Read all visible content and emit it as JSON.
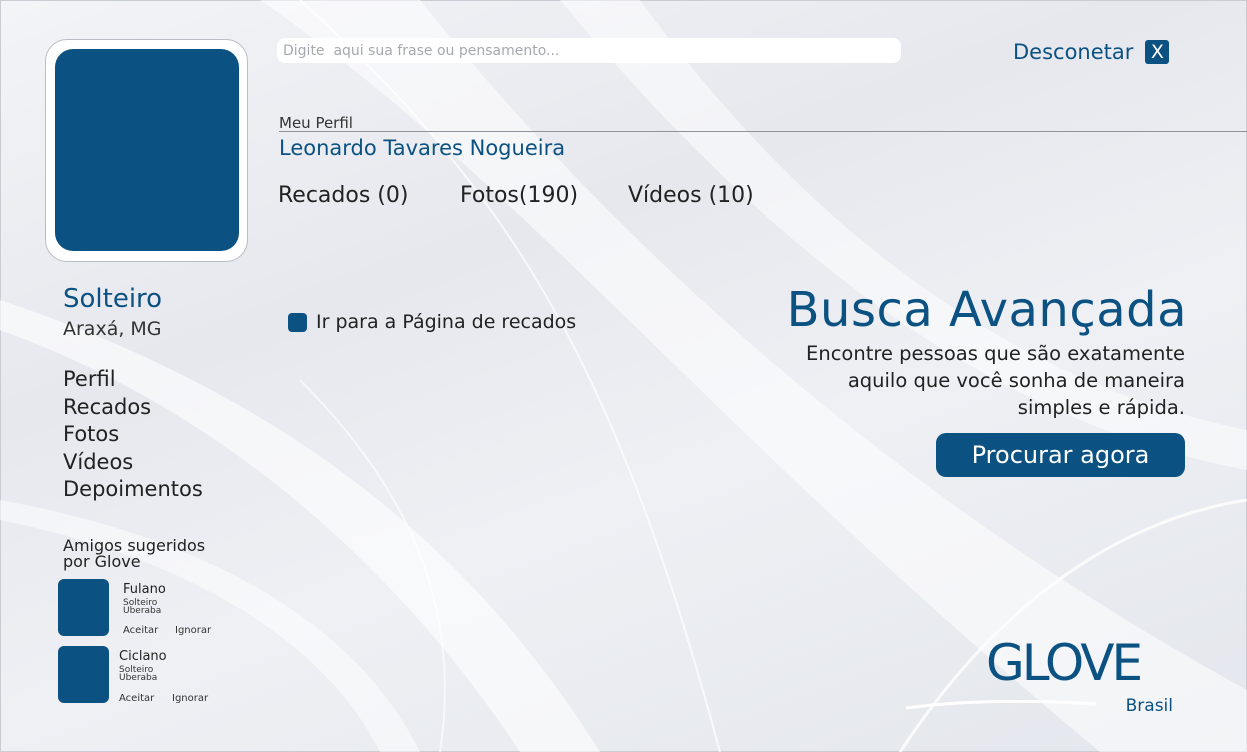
{
  "status_input": {
    "placeholder": "Digite  aqui sua frase ou pensamento..."
  },
  "logout": {
    "label": "Desconetar",
    "close_symbol": "X"
  },
  "profile": {
    "section_title": "Meu Perfil",
    "name": "Leonardo Tavares Nogueira",
    "stats": {
      "recados": "Recados (0)",
      "fotos": "Fotos(190)",
      "videos": "Vídeos (10)"
    }
  },
  "sidebar": {
    "relationship_status": "Solteiro",
    "location": "Araxá, MG",
    "nav": [
      "Perfil",
      "Recados",
      "Fotos",
      "Vídeos",
      "Depoimentos"
    ],
    "suggested_title_line1": "Amigos sugeridos",
    "suggested_title_line2": "por  Glove",
    "friends": [
      {
        "name": "Fulano",
        "status": "Solteiro",
        "city": "Uberaba",
        "accept": "Aceitar",
        "ignore": "Ignorar"
      },
      {
        "name": "Ciclano",
        "status": "Solteiro",
        "city": "Uberaba",
        "accept": "Aceitar",
        "ignore": "Ignorar"
      }
    ]
  },
  "goto_recados": {
    "label": "Ir para a Página de recados"
  },
  "advanced_search": {
    "title": "Busca Avançada",
    "description_line1": "Encontre pessoas que são exatamente",
    "description_line2": "aquilo que você sonha de maneira",
    "description_line3": "simples e rápida.",
    "button_label": "Procurar agora"
  },
  "brand": {
    "logo_text": "GLOVE",
    "logo_sub": "Brasil"
  },
  "colors": {
    "primary": "#0b5282",
    "text": "#222222",
    "background": "#eceef2"
  }
}
